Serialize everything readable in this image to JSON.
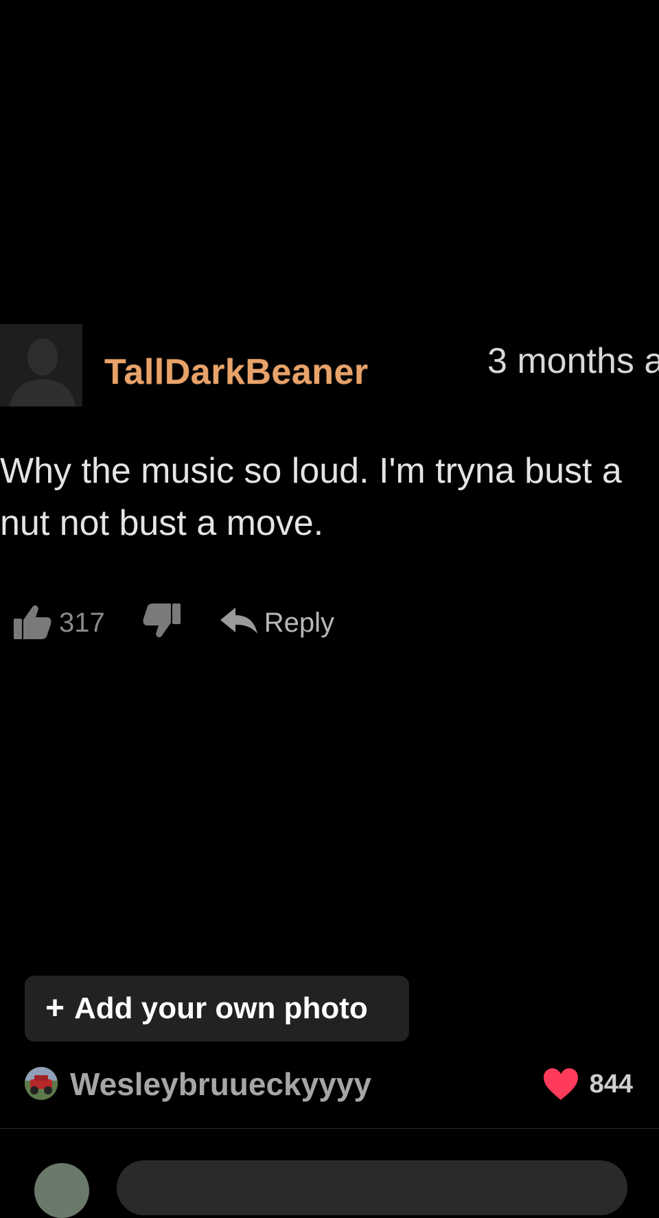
{
  "photo": {
    "comment": {
      "username": "TallDarkBeaner",
      "time": "3 months a",
      "body_lines": [
        "Why the music so loud. I'm tryna bust a",
        "nut not bust a move."
      ],
      "like_count": "317",
      "reply_label": "Reply"
    }
  },
  "add_photo": {
    "plus": "+",
    "label": "Add your own photo"
  },
  "author": {
    "name": "Wesleybruueckyyyy",
    "likes": "844"
  },
  "colors": {
    "username": "#e8a36a",
    "heart": "#ff3b5c",
    "button_bg": "#222222"
  },
  "icons": {
    "back": "back-arrow-icon",
    "more": "more-dots-icon",
    "like": "thumbs-up-icon",
    "dislike": "thumbs-down-icon",
    "reply": "reply-arrow-icon",
    "heart": "heart-icon"
  }
}
